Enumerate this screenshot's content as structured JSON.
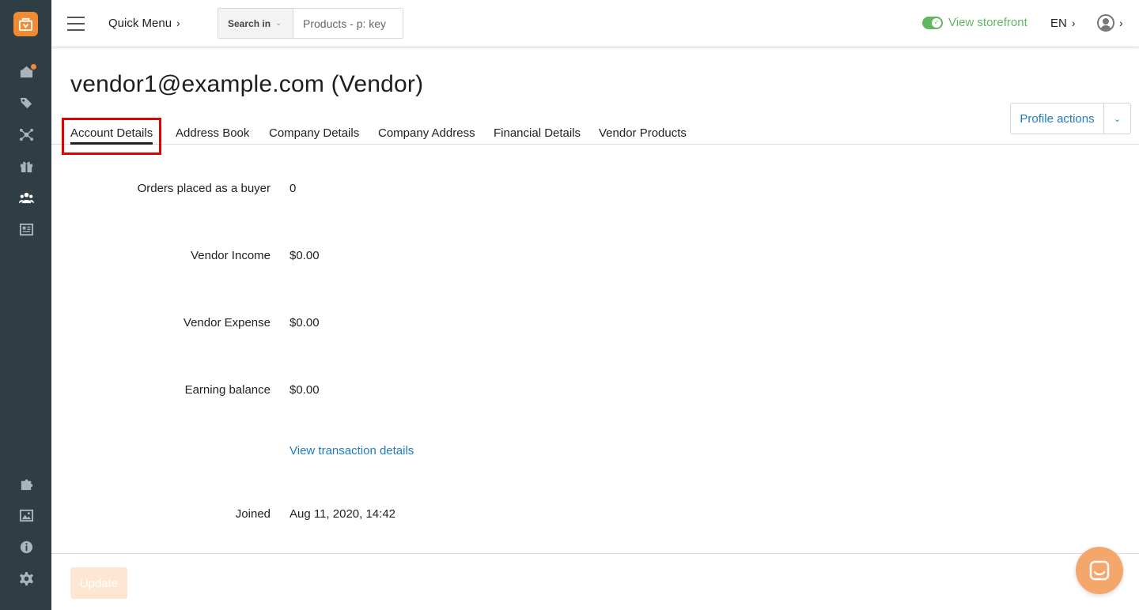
{
  "sidebar": {
    "items": [
      {
        "icon": "dashboard-icon",
        "active": false,
        "has_badge": true
      },
      {
        "icon": "tags-icon",
        "active": false
      },
      {
        "icon": "network-icon",
        "active": false
      },
      {
        "icon": "gift-icon",
        "active": false
      },
      {
        "icon": "users-icon",
        "active": true
      },
      {
        "icon": "newspaper-icon",
        "active": false
      },
      {
        "icon": "puzzle-icon",
        "active": false
      },
      {
        "icon": "image-icon",
        "active": false
      },
      {
        "icon": "info-icon",
        "active": false
      },
      {
        "icon": "gear-icon",
        "active": false
      }
    ],
    "badge_color": "#f28a32"
  },
  "topbar": {
    "quick_menu": "Quick Menu",
    "chevron": "›",
    "search_in": "Search in",
    "search_placeholder": "Products - p: key",
    "storefront": "View storefront",
    "language": "EN"
  },
  "page": {
    "title": "vendor1@example.com (Vendor)",
    "profile_actions": "Profile actions"
  },
  "tabs": [
    {
      "label": "Account Details",
      "active": true
    },
    {
      "label": "Address Book",
      "active": false
    },
    {
      "label": "Company Details",
      "active": false
    },
    {
      "label": "Company Address",
      "active": false
    },
    {
      "label": "Financial Details",
      "active": false
    },
    {
      "label": "Vendor Products",
      "active": false
    }
  ],
  "fields": {
    "orders": {
      "label": "Orders placed as a buyer",
      "value": "0"
    },
    "income": {
      "label": "Vendor Income",
      "value": "$0.00"
    },
    "expense": {
      "label": "Vendor Expense",
      "value": "$0.00"
    },
    "balance": {
      "label": "Earning balance",
      "value": "$0.00"
    },
    "transactions_link": "View transaction details",
    "joined": {
      "label": "Joined",
      "value": "Aug 11, 2020, 14:42"
    }
  },
  "footer": {
    "update": "Update"
  },
  "colors": {
    "sidebar_bg": "#2f3d44",
    "brand": "#f28a32",
    "link": "#1e7bc1",
    "storefront_green": "#5fb85f",
    "highlight": "#e30000"
  }
}
